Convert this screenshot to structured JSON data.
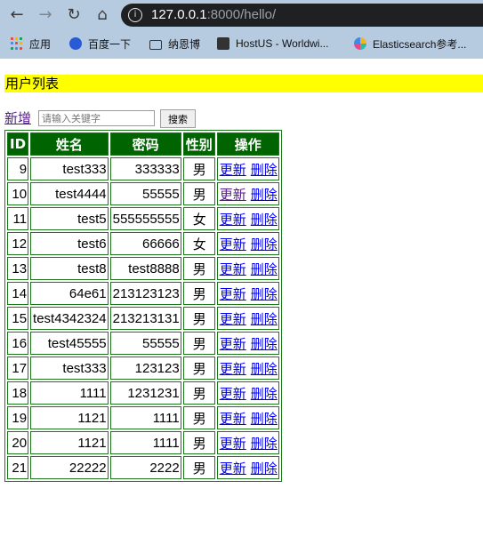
{
  "browser": {
    "url_host": "127.0.0.1",
    "url_rest": ":8000/hello/",
    "bookmarks": [
      {
        "label": "应用",
        "icon": "apps-grid-icon"
      },
      {
        "label": "百度一下",
        "icon": "baidu-paw-icon"
      },
      {
        "label": "纳恩博",
        "icon": "folder-icon"
      },
      {
        "label": "HostUS - Worldwi...",
        "icon": "hostus-icon"
      },
      {
        "label": "Elasticsearch参考...",
        "icon": "elastic-icon"
      }
    ]
  },
  "page": {
    "banner": "用户列表",
    "add_label": "新增",
    "search_placeholder": "请输入关键字",
    "search_button": "搜索"
  },
  "table": {
    "headers": [
      "ID",
      "姓名",
      "密码",
      "性别",
      "操作"
    ],
    "update_label": "更新",
    "delete_label": "删除",
    "rows": [
      {
        "id": "9",
        "name": "test333",
        "password": "333333",
        "gender": "男"
      },
      {
        "id": "10",
        "name": "test4444",
        "password": "55555",
        "gender": "男"
      },
      {
        "id": "11",
        "name": "test5",
        "password": "555555555",
        "gender": "女"
      },
      {
        "id": "12",
        "name": "test6",
        "password": "66666",
        "gender": "女"
      },
      {
        "id": "13",
        "name": "test8",
        "password": "test8888",
        "gender": "男"
      },
      {
        "id": "14",
        "name": "64e61",
        "password": "213123123",
        "gender": "男"
      },
      {
        "id": "15",
        "name": "test4342324",
        "password": "213213131",
        "gender": "男"
      },
      {
        "id": "16",
        "name": "test45555",
        "password": "55555",
        "gender": "男"
      },
      {
        "id": "17",
        "name": "test333",
        "password": "123123",
        "gender": "男"
      },
      {
        "id": "18",
        "name": "1111",
        "password": "1231231",
        "gender": "男"
      },
      {
        "id": "19",
        "name": "1121",
        "password": "1111",
        "gender": "男"
      },
      {
        "id": "20",
        "name": "1121",
        "password": "1111",
        "gender": "男"
      },
      {
        "id": "21",
        "name": "22222",
        "password": "2222",
        "gender": "男"
      }
    ]
  },
  "colors": {
    "header_bg": "#006400",
    "banner_bg": "#ffff00",
    "link": "#0000ee",
    "visited_link": "#551a8b"
  }
}
